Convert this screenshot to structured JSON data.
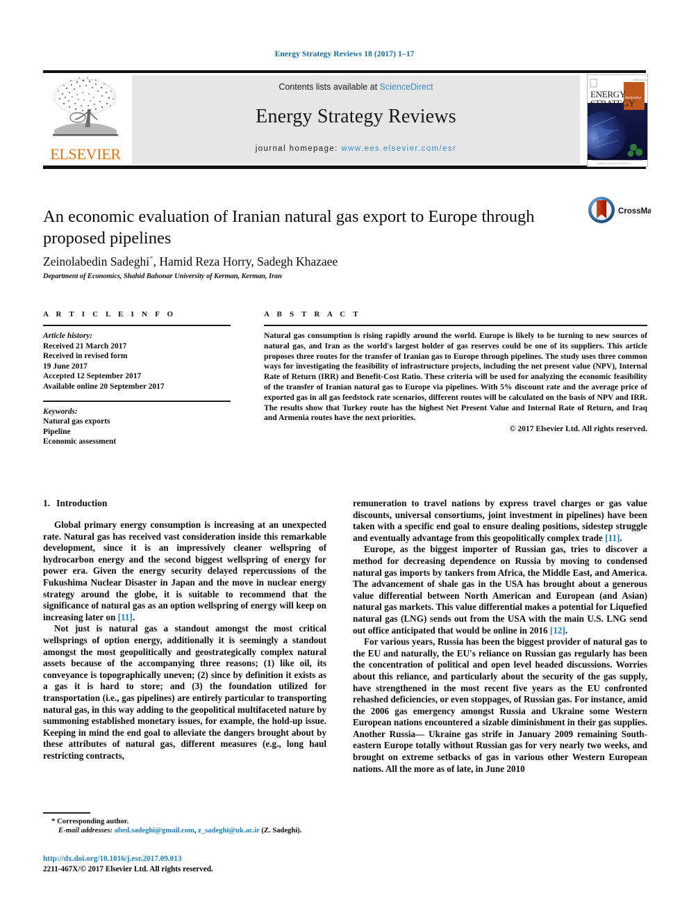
{
  "running_head": "Energy Strategy Reviews 18 (2017) 1–17",
  "masthead": {
    "publisher_wordmark": "ELSEVIER",
    "contents_prefix": "Contents lists available at ",
    "contents_link": "ScienceDirect",
    "journal_title": "Energy Strategy Reviews",
    "homepage_prefix": "journal homepage: ",
    "homepage_url": "www.ees.elsevier.com/esr",
    "cover_title_line1": "ENERGY",
    "cover_title_line2": "STRATEGY"
  },
  "article": {
    "title": "An economic evaluation of Iranian natural gas export to Europe through proposed pipelines",
    "authors_html": "Zeinolabedin Sadeghi<sup>*</sup>, Hamid Reza Horry, Sadegh Khazaee",
    "affiliation": "Department of Economics, Shahid Bahonar University of Kerman, Kerman, Iran",
    "crossmark_label": "CrossMark"
  },
  "info": {
    "heading": "A R T I C L E  I N F O",
    "history_label": "Article history:",
    "history": [
      "Received 21 March 2017",
      "Received in revised form",
      "19 June 2017",
      "Accepted 12 September 2017",
      "Available online 20 September 2017"
    ],
    "keywords_label": "Keywords:",
    "keywords": [
      "Natural gas exports",
      "Pipeline",
      "Economic assessment"
    ]
  },
  "abstract": {
    "heading": "A B S T R A C T",
    "text": "Natural gas consumption is rising rapidly around the world. Europe is likely to be turning to new sources of natural gas, and Iran as the world's largest holder of gas reserves could be one of its suppliers. This article proposes three routes for the transfer of Iranian gas to Europe through pipelines. The study uses three common ways for investigating the feasibility of infrastructure projects, including the net present value (NPV), Internal Rate of Return (IRR) and Benefit-Cost Ratio. These criteria will be used for analyzing the economic feasibility of the transfer of Iranian natural gas to Europe via pipelines. With 5% discount rate and the average price of exported gas in all gas feedstock rate scenarios, different routes will be calculated on the basis of NPV and IRR. The results show that Turkey route has the highest Net Present Value and Internal Rate of Return, and Iraq and Armenia routes have the next priorities.",
    "copyright": "© 2017 Elsevier Ltd. All rights reserved."
  },
  "body": {
    "section_number": "1.",
    "section_title": "Introduction",
    "left_paragraphs": [
      {
        "before": "Global primary energy consumption is increasing at an unexpected rate. Natural gas has received vast consideration inside this remarkable development, since it is an impressively cleaner wellspring of hydrocarbon energy and the second biggest wellspring of energy for power era. Given the energy security delayed repercussions of the Fukushima Nuclear Disaster in Japan and the move in nuclear energy strategy around the globe, it is suitable to recommend that the significance of natural gas as an option wellspring of energy will keep on increasing later on ",
        "ref": "[11]",
        "after": "."
      },
      {
        "before": "Not just is natural gas a standout amongst the most critical wellsprings of option energy, additionally it is seemingly a standout amongst the most geopolitically and geostrategically complex natural assets because of the accompanying three reasons; (1) like oil, its conveyance is topographically uneven; (2) since by definition it exists as a gas it is hard to store; and (3) the foundation utilized for transportation (i.e., gas pipelines) are entirely particular to transporting natural gas, in this way adding to the geopolitical multifaceted nature by summoning established monetary issues, for example, the hold-up issue. Keeping in mind the end goal to alleviate the dangers brought about by these attributes of natural gas, different measures (e.g., long haul restricting contracts,",
        "ref": "",
        "after": ""
      }
    ],
    "right_paragraphs": [
      {
        "before": "remuneration to travel nations by express travel charges or gas value discounts, universal consortiums, joint investment in pipelines) have been taken with a specific end goal to ensure dealing positions, sidestep struggle and eventually advantage from this geopolitically complex trade ",
        "ref": "[11]",
        "after": "."
      },
      {
        "before": "Europe, as the biggest importer of Russian gas, tries to discover a method for decreasing dependence on Russia by moving to condensed natural gas imports by tankers from Africa, the Middle East, and America. The advancement of shale gas in the USA has brought about a generous value differential between North American and European (and Asian) natural gas markets. This value differential makes a potential for Liquefied natural gas (LNG) sends out from the USA with the main U.S. LNG send out office anticipated that would be online in 2016 ",
        "ref": "[12]",
        "after": "."
      },
      {
        "before": "For various years, Russia has been the biggest provider of natural gas to the EU and naturally, the EU's reliance on Russian gas regularly has been the concentration of political and open level headed discussions. Worries about this reliance, and particularly about the security of the gas supply, have strengthened in the most recent five years as the EU confronted rehashed deficiencies, or even stoppages, of Russian gas. For instance, amid the 2006 gas emergency amongst Russia and Ukraine some Western European nations encountered a sizable diminishment in their gas supplies. Another Russia— Ukraine gas strife in January 2009 remaining South-eastern Europe totally without Russian gas for very nearly two weeks, and brought on extreme setbacks of gas in various other Western European nations. All the more as of late, in June 2010",
        "ref": "",
        "after": ""
      }
    ]
  },
  "footnote": {
    "corresponding": "Corresponding author.",
    "email_label": "E-mail addresses:",
    "email1": "abed.sadeghi@gmail.com",
    "email2": "z_sadeghi@uk.ac.ir",
    "email_suffix": "(Z. Sadeghi).",
    "doi": "http://dx.doi.org/10.1016/j.esr.2017.09.013",
    "issn_line": "2211-467X/© 2017 Elsevier Ltd. All rights reserved."
  },
  "colors": {
    "link_blue": "#1a7fc1",
    "elsevier_orange": "#eb7004",
    "masthead_grey": "#e6e6e6",
    "header_blue": "#1168a8"
  }
}
